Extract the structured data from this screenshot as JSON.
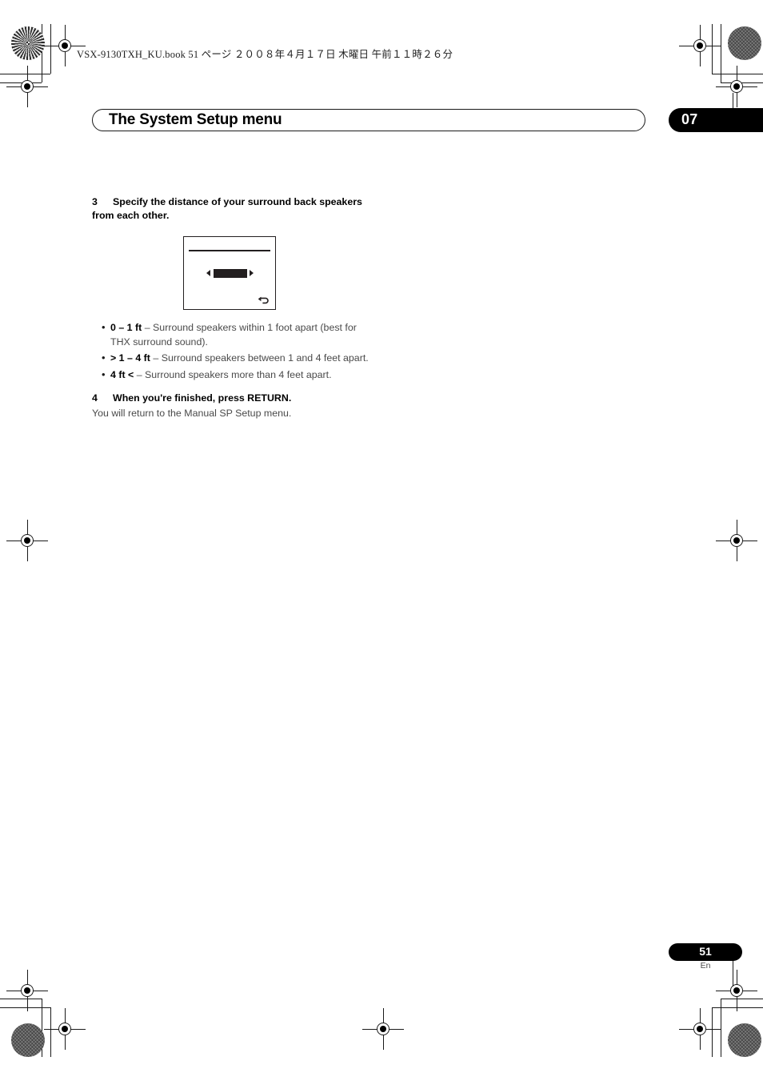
{
  "document": {
    "file_header": "VSX-9130TXH_KU.book   51 ページ   ２００８年４月１７日   木曜日   午前１１時２６分"
  },
  "chapter": {
    "title": "The System Setup menu",
    "number": "07"
  },
  "steps": [
    {
      "number": "3",
      "text": "Specify the distance of your surround back speakers from each other."
    },
    {
      "number": "4",
      "text": "When you're finished, press RETURN.",
      "note": "You will return to the Manual SP Setup menu."
    }
  ],
  "osd": {
    "return_icon": "return-arrow-icon",
    "left_arrow": "left-triangle-icon",
    "right_arrow": "right-triangle-icon",
    "value_bar": "selected-value-bar"
  },
  "bullets": [
    {
      "term": "0 – 1 ft",
      "description": " – Surround speakers within 1 foot apart (best for THX surround sound)."
    },
    {
      "term": "> 1 – 4 ft",
      "description": " – Surround speakers between 1 and 4 feet apart."
    },
    {
      "term": "4 ft <",
      "description": " – Surround speakers more than 4 feet apart."
    }
  ],
  "footer": {
    "page_number": "51",
    "language": "En"
  },
  "colors": {
    "accent_black": "#000000",
    "body_text": "#4a4a4a",
    "rule": "#231f20"
  }
}
